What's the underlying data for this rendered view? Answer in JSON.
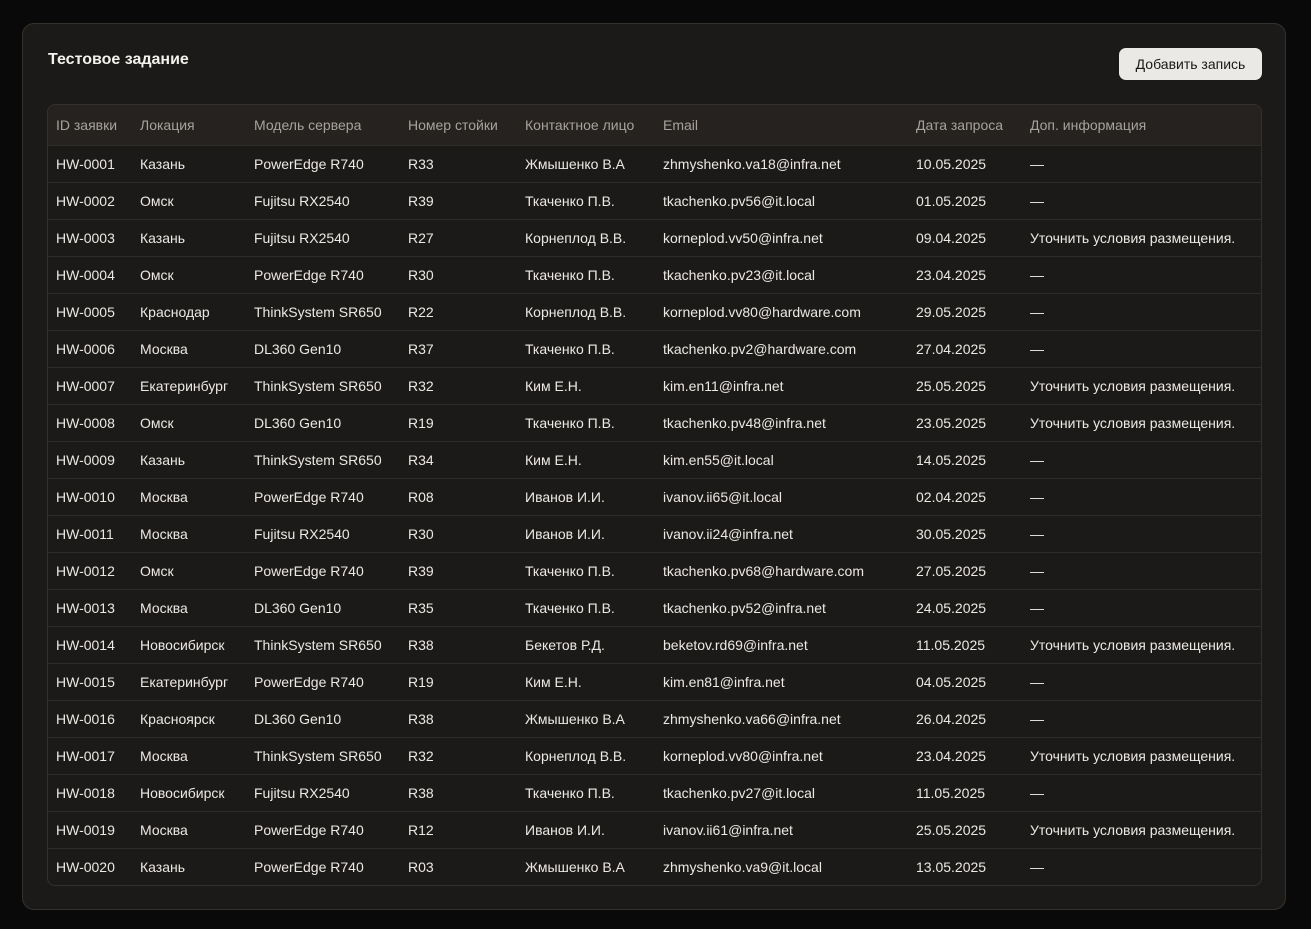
{
  "page": {
    "title": "Тестовое задание",
    "add_button_label": "Добавить запись"
  },
  "table": {
    "columns": [
      "ID заявки",
      "Локация",
      "Модель сервера",
      "Номер стойки",
      "Контактное лицо",
      "Email",
      "Дата запроса",
      "Доп. информация"
    ],
    "rows": [
      [
        "HW-0001",
        "Казань",
        "PowerEdge R740",
        "R33",
        "Жмышенко В.А",
        "zhmyshenko.va18@infra.net",
        "10.05.2025",
        "—"
      ],
      [
        "HW-0002",
        "Омск",
        "Fujitsu RX2540",
        "R39",
        "Ткаченко П.В.",
        "tkachenko.pv56@it.local",
        "01.05.2025",
        "—"
      ],
      [
        "HW-0003",
        "Казань",
        "Fujitsu RX2540",
        "R27",
        "Корнеплод В.В.",
        "korneplod.vv50@infra.net",
        "09.04.2025",
        "Уточнить условия размещения."
      ],
      [
        "HW-0004",
        "Омск",
        "PowerEdge R740",
        "R30",
        "Ткаченко П.В.",
        "tkachenko.pv23@it.local",
        "23.04.2025",
        "—"
      ],
      [
        "HW-0005",
        "Краснодар",
        "ThinkSystem SR650",
        "R22",
        "Корнеплод В.В.",
        "korneplod.vv80@hardware.com",
        "29.05.2025",
        "—"
      ],
      [
        "HW-0006",
        "Москва",
        "DL360 Gen10",
        "R37",
        "Ткаченко П.В.",
        "tkachenko.pv2@hardware.com",
        "27.04.2025",
        "—"
      ],
      [
        "HW-0007",
        "Екатеринбург",
        "ThinkSystem SR650",
        "R32",
        "Ким Е.Н.",
        "kim.en11@infra.net",
        "25.05.2025",
        "Уточнить условия размещения."
      ],
      [
        "HW-0008",
        "Омск",
        "DL360 Gen10",
        "R19",
        "Ткаченко П.В.",
        "tkachenko.pv48@infra.net",
        "23.05.2025",
        "Уточнить условия размещения."
      ],
      [
        "HW-0009",
        "Казань",
        "ThinkSystem SR650",
        "R34",
        "Ким Е.Н.",
        "kim.en55@it.local",
        "14.05.2025",
        "—"
      ],
      [
        "HW-0010",
        "Москва",
        "PowerEdge R740",
        "R08",
        "Иванов И.И.",
        "ivanov.ii65@it.local",
        "02.04.2025",
        "—"
      ],
      [
        "HW-0011",
        "Москва",
        "Fujitsu RX2540",
        "R30",
        "Иванов И.И.",
        "ivanov.ii24@infra.net",
        "30.05.2025",
        "—"
      ],
      [
        "HW-0012",
        "Омск",
        "PowerEdge R740",
        "R39",
        "Ткаченко П.В.",
        "tkachenko.pv68@hardware.com",
        "27.05.2025",
        "—"
      ],
      [
        "HW-0013",
        "Москва",
        "DL360 Gen10",
        "R35",
        "Ткаченко П.В.",
        "tkachenko.pv52@infra.net",
        "24.05.2025",
        "—"
      ],
      [
        "HW-0014",
        "Новосибирск",
        "ThinkSystem SR650",
        "R38",
        "Бекетов Р.Д.",
        "beketov.rd69@infra.net",
        "11.05.2025",
        "Уточнить условия размещения."
      ],
      [
        "HW-0015",
        "Екатеринбург",
        "PowerEdge R740",
        "R19",
        "Ким Е.Н.",
        "kim.en81@infra.net",
        "04.05.2025",
        "—"
      ],
      [
        "HW-0016",
        "Красноярск",
        "DL360 Gen10",
        "R38",
        "Жмышенко В.А",
        "zhmyshenko.va66@infra.net",
        "26.04.2025",
        "—"
      ],
      [
        "HW-0017",
        "Москва",
        "ThinkSystem SR650",
        "R32",
        "Корнеплод В.В.",
        "korneplod.vv80@infra.net",
        "23.04.2025",
        "Уточнить условия размещения."
      ],
      [
        "HW-0018",
        "Новосибирск",
        "Fujitsu RX2540",
        "R38",
        "Ткаченко П.В.",
        "tkachenko.pv27@it.local",
        "11.05.2025",
        "—"
      ],
      [
        "HW-0019",
        "Москва",
        "PowerEdge R740",
        "R12",
        "Иванов И.И.",
        "ivanov.ii61@infra.net",
        "25.05.2025",
        "Уточнить условия размещения."
      ],
      [
        "HW-0020",
        "Казань",
        "PowerEdge R740",
        "R03",
        "Жмышенко В.А",
        "zhmyshenko.va9@it.local",
        "13.05.2025",
        "—"
      ]
    ]
  }
}
